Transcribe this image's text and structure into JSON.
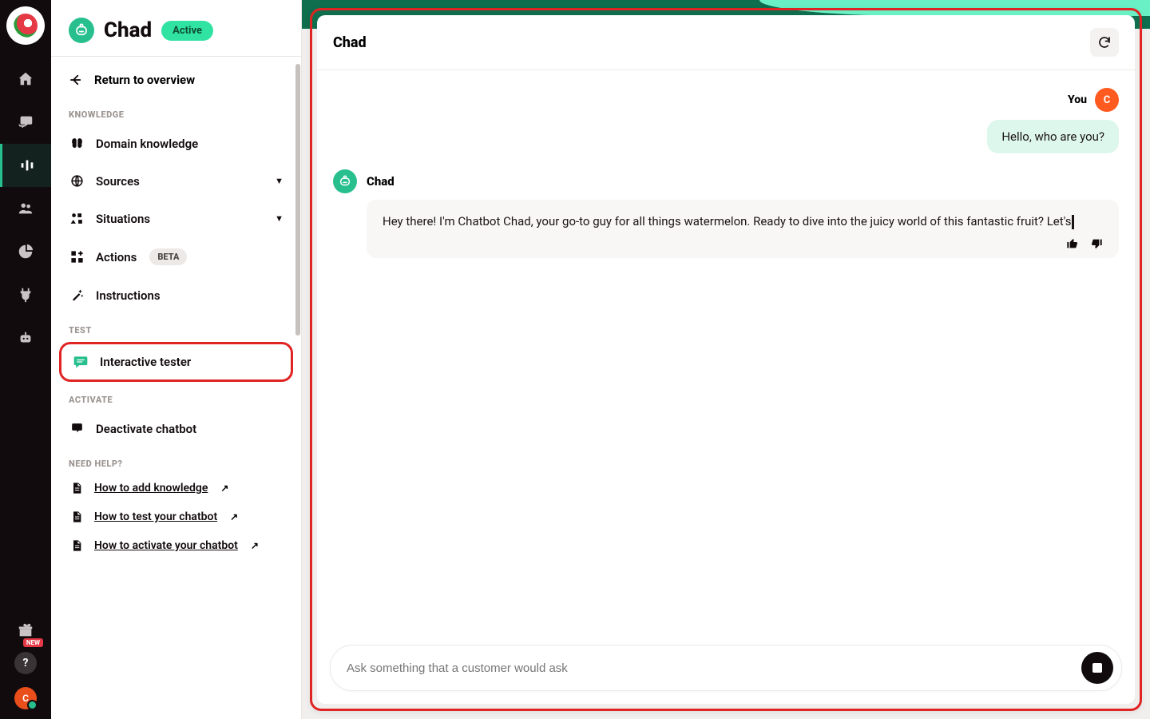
{
  "rail": {
    "new_badge": "NEW",
    "help_glyph": "?",
    "avatar_initial": "C"
  },
  "sidebar": {
    "bot_name": "Chad",
    "status": "Active",
    "return_label": "Return to overview",
    "sections": {
      "knowledge": "KNOWLEDGE",
      "test": "TEST",
      "activate": "ACTIVATE",
      "need_help": "NEED HELP?"
    },
    "items": {
      "domain_knowledge": "Domain knowledge",
      "sources": "Sources",
      "situations": "Situations",
      "actions": "Actions",
      "actions_badge": "BETA",
      "instructions": "Instructions",
      "interactive_tester": "Interactive tester",
      "deactivate": "Deactivate chatbot"
    },
    "help_links": {
      "add_knowledge": "How to add knowledge",
      "test_chatbot": "How to test your chatbot",
      "activate_chatbot": "How to activate your chatbot"
    }
  },
  "chat": {
    "title": "Chad",
    "you_label": "You",
    "you_initial": "C",
    "user_message": "Hello, who are you?",
    "bot_name": "Chad",
    "bot_message": "Hey there!  I'm Chatbot Chad, your go-to guy for all things watermelon. Ready to dive into the juicy world of this fantastic fruit?  Let's",
    "input_placeholder": "Ask something that a customer would ask"
  }
}
